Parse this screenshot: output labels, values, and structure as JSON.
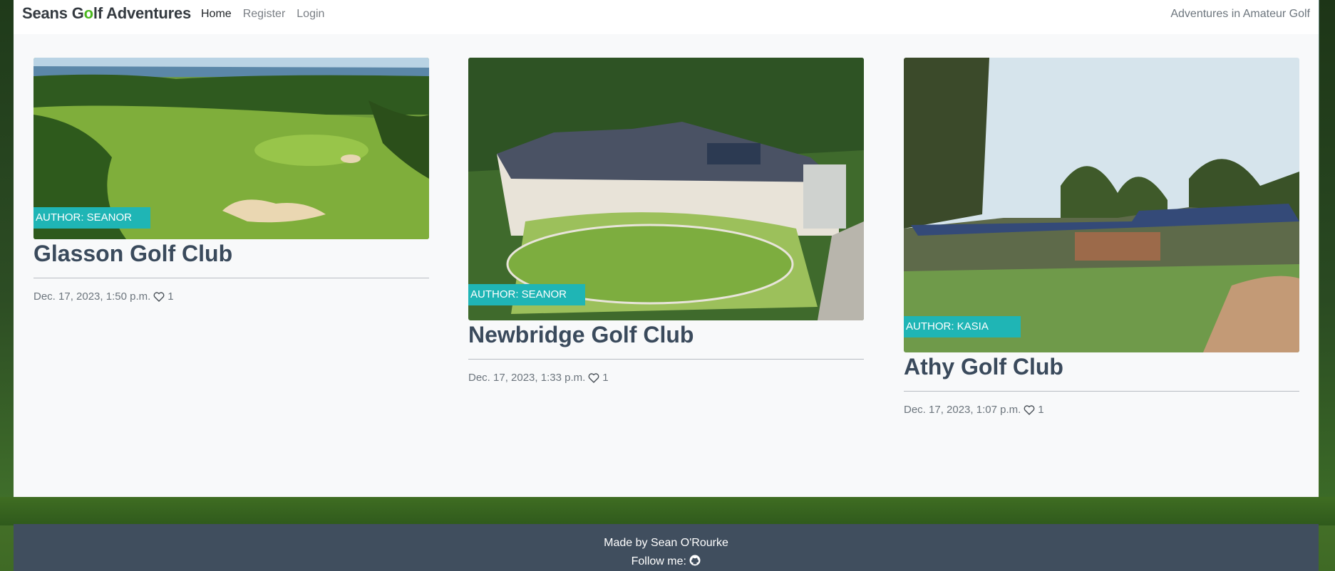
{
  "brand": {
    "prefix": "Seans G",
    "o": "o",
    "suffix": "lf Adventures"
  },
  "nav": {
    "home": "Home",
    "register": "Register",
    "login": "Login"
  },
  "tagline": "Adventures in Amateur Golf",
  "posts": [
    {
      "title": "Glasson Golf Club",
      "author": "AUTHOR: SEANOR",
      "date": "Dec. 17, 2023, 1:50 p.m.",
      "likes": "1"
    },
    {
      "title": "Newbridge Golf Club",
      "author": "AUTHOR: SEANOR",
      "date": "Dec. 17, 2023, 1:33 p.m.",
      "likes": "1"
    },
    {
      "title": "Athy Golf Club",
      "author": "AUTHOR: KASIA",
      "date": "Dec. 17, 2023, 1:07 p.m.",
      "likes": "1"
    }
  ],
  "footer": {
    "made_by": "Made by Sean O'Rourke",
    "follow": "Follow me:",
    "follow_icon": "github-icon"
  },
  "colors": {
    "badge": "#1fb5b5",
    "brand_accent": "#4cb81f",
    "footer_bg": "#404e5e"
  }
}
